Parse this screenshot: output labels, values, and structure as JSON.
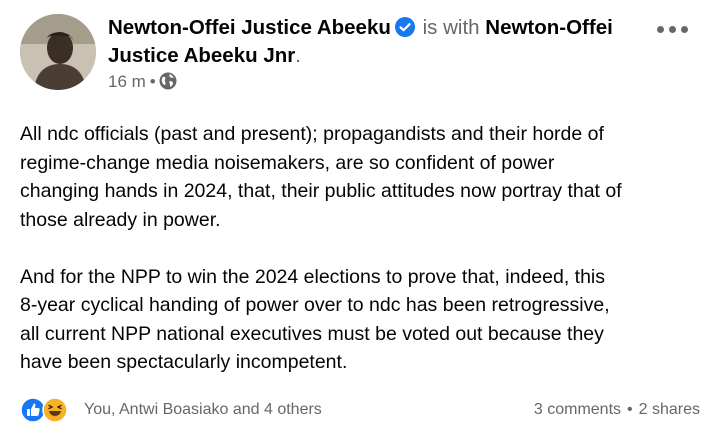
{
  "author": {
    "name": "Newton-Offei Justice Abeeku",
    "with_text": "is with",
    "tagged_first": "Newton-Offei",
    "tagged_second": "Justice Abeeku Jnr",
    "tagged_suffix": "."
  },
  "meta": {
    "time": "16 m",
    "separator": "•",
    "audience_icon": "globe-icon"
  },
  "body": {
    "paragraph1_lines": [
      "All ndc officials (past and present); propagandists and their horde of",
      "regime-change media noisemakers, are so confident of power",
      "changing hands in 2024, that, their public attitudes now portray that of",
      "those already in power."
    ],
    "paragraph2_lines": [
      "And for the NPP to win the 2024 elections to prove that, indeed, this",
      "8-year cyclical handing of power over to ndc has been retrogressive,",
      "all current NPP national executives must be voted out because they",
      "have been spectacularly incompetent."
    ]
  },
  "footer": {
    "reaction_icons": [
      "like-icon",
      "haha-icon"
    ],
    "reaction_names": "You, Antwi Boasiako and 4 others",
    "comments": "3 comments",
    "separator": "•",
    "shares": "2 shares"
  },
  "colors": {
    "primary_text": "#050505",
    "secondary_text": "#65676b",
    "verified_blue": "#1877f2",
    "like_blue": "#1877f2",
    "haha_yellow": "#f7b125"
  }
}
